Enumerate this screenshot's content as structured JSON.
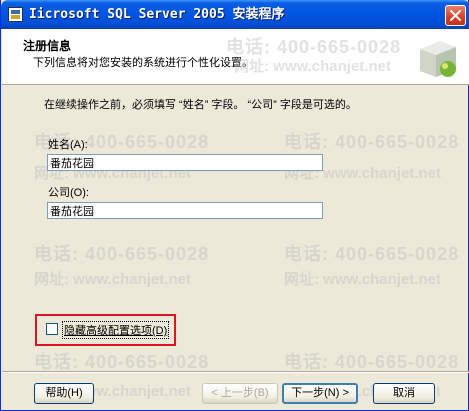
{
  "window": {
    "title": "Iicrosoft SQL Server 2005 安装程序"
  },
  "header": {
    "title": "注册信息",
    "subtitle": "下列信息将对您安装的系统进行个性化设置。"
  },
  "main": {
    "instructions": "在继续操作之前，必须填写 “姓名” 字段。 “公司” 字段是可选的。",
    "name_label": "姓名(A):",
    "name_value": "番茄花园",
    "company_label": "公司(O):",
    "company_value": "番茄花园",
    "hide_advanced_label": "隐藏高级配置选项(D)",
    "hide_advanced_checked": false
  },
  "watermark": {
    "phone": "电话: 400-665-0028",
    "site": "网址: www.chanjet.net"
  },
  "buttons": {
    "help": "帮助(H)",
    "back": "< 上一步(B)",
    "next": "下一步(N) >",
    "cancel": "取消"
  },
  "colors": {
    "titlebar": "#0054e3",
    "highlight_box": "#e0141e",
    "window_bg": "#ece9d8"
  }
}
